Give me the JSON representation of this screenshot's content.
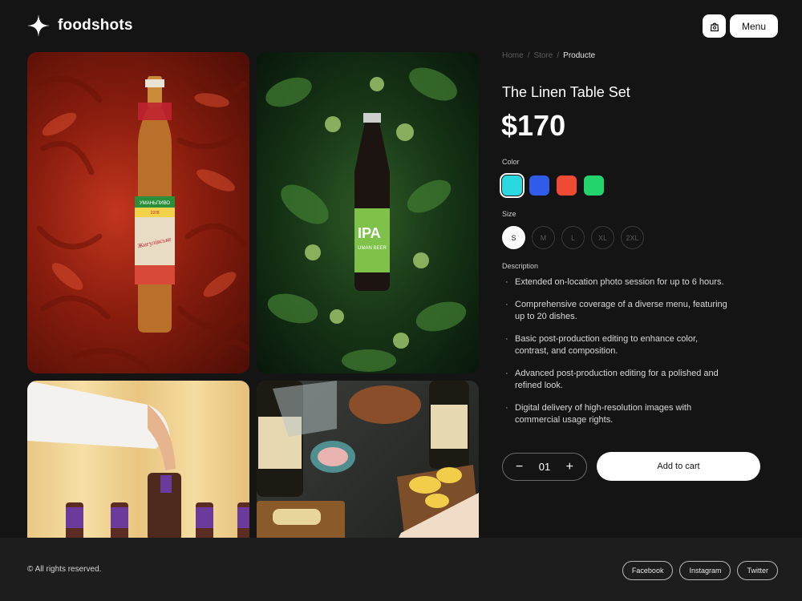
{
  "brand": {
    "name": "foodshots"
  },
  "header": {
    "cart_icon": "bag-icon",
    "menu_label": "Menu"
  },
  "breadcrumb": {
    "items": [
      "Home",
      "Store",
      "Producte"
    ]
  },
  "product": {
    "title": "The Linen Table Set",
    "price": "$170",
    "color_label": "Color",
    "colors": [
      "#2ad8e0",
      "#2f5ce8",
      "#ef4a33",
      "#22d46b"
    ],
    "selected_color": "#2ad8e0",
    "size_label": "Size",
    "sizes": [
      "S",
      "M",
      "L",
      "XL",
      "2XL"
    ],
    "selected_size": "S",
    "description_label": "Description",
    "description": [
      "Extended on-location photo session for up to 6 hours.",
      "Comprehensive coverage of a diverse menu, featuring up to 20 dishes.",
      "Basic post-production editing to enhance color, contrast, and composition.",
      "Advanced post-production editing for a polished and refined look.",
      "Digital delivery of high-resolution images with commercial usage rights."
    ],
    "quantity": "01",
    "add_to_cart": "Add to cart"
  },
  "gallery": {
    "images": [
      {
        "labels": [
          "УМАНЬПИВО",
          "1978",
          "Жигулівське"
        ]
      },
      {
        "labels": [
          "IPA",
          "UMAN BEER"
        ]
      },
      {
        "labels": []
      },
      {
        "labels": []
      }
    ]
  },
  "footer": {
    "copyright": "© All rights reserved.",
    "links": [
      "Facebook",
      "Instagram",
      "Twitter"
    ]
  }
}
